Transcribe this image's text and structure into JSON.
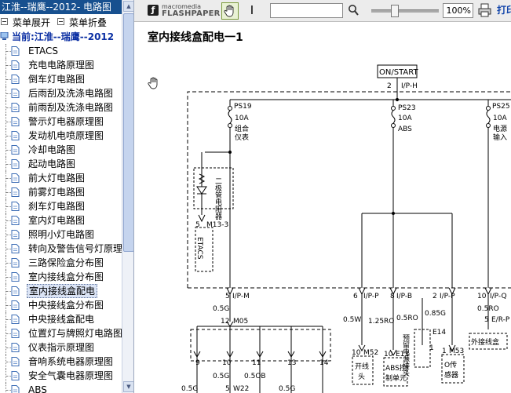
{
  "tree": {
    "title": "江淮--瑞鹰--2012- 电路图",
    "expand_all": "菜单展开",
    "collapse_all": "菜单折叠",
    "current": "当前:江淮--瑞鹰--2012",
    "items": [
      "ETACS",
      "充电电路原理图",
      "倒车灯电路图",
      "后雨刮及洗涤电路图",
      "前雨刮及洗涤电路图",
      "警示灯电器原理图",
      "发动机电喷原理图",
      "冷却电路图",
      "起动电路图",
      "前大灯电路图",
      "前雾灯电路图",
      "刹车灯电路图",
      "室内灯电路图",
      "照明小灯电路图",
      "转向及警告信号灯原理",
      "三路保险盒分布图",
      "室内接线盒分布图",
      "室内接线盒配电",
      "中央接线盒分布图",
      "中央接线盒配电",
      "位置灯与牌照灯电路图",
      "仪表指示原理图",
      "音响系统电器原理图",
      "安全气囊电器原理图",
      "ABS"
    ],
    "selected_index": 17
  },
  "viewer": {
    "logo_small": "macromedia",
    "logo_big": "FLASHPAPER",
    "search_value": "",
    "zoom": "100%",
    "print_label": "打印",
    "page_title": "室内接线盒配电一1"
  },
  "diagram": {
    "on_start": "ON/START",
    "top_pin": "2",
    "top_conn": "I/P-H",
    "fuses": [
      {
        "id": "PS19",
        "amp": "10A",
        "desc1": "组合",
        "desc2": "仪表"
      },
      {
        "id": "PS23",
        "amp": "10A",
        "desc1": "ABS",
        "desc2": ""
      },
      {
        "id": "PS25",
        "amp": "10A",
        "desc1": "电源",
        "desc2": "输入"
      }
    ],
    "diode_label": "二极管电阻器",
    "left_conn": {
      "pin": "5",
      "name": "M13-3",
      "module": "ETACS"
    },
    "bottom_conns": [
      {
        "pin": "5",
        "name": "I/P-M"
      },
      {
        "pin": "6",
        "name": "I/P-P"
      },
      {
        "pin": "8",
        "name": "I/P-B"
      },
      {
        "pin": "2",
        "name": "I/P-P"
      },
      {
        "pin": "10",
        "name": "I/P-Q"
      },
      {
        "pin": "5",
        "name": "E/R-P"
      }
    ],
    "wire_labels": {
      "w1": "0.5G",
      "w2": "0.5W",
      "w3": "1.25RO",
      "w4": "0.5RO",
      "w5": "0.85G",
      "w6": "0.5RO",
      "m05_pin": "12",
      "m05": "M05",
      "e14": "E14",
      "e14_pin": "1"
    },
    "relay_text": "预留电源接头",
    "bottom_pins": [
      "9",
      "10",
      "11",
      "13",
      "14"
    ],
    "bottom_wires": [
      "0.5G",
      "0.5G",
      "0.5OB",
      "0.5G"
    ],
    "w22": "W22",
    "w22_pin": "5",
    "modules": [
      {
        "conn": "M52",
        "pin": "10",
        "text1": "开线",
        "text2": "头"
      },
      {
        "conn": "E13",
        "pin": "10",
        "text1": "ABS控",
        "text2": "制单元"
      },
      {
        "conn": "M53",
        "pin": "1",
        "text1": "O传",
        "text2": "感器"
      },
      {
        "conn": "",
        "pin": "",
        "text1": "外接线盒",
        "text2": ""
      }
    ]
  }
}
